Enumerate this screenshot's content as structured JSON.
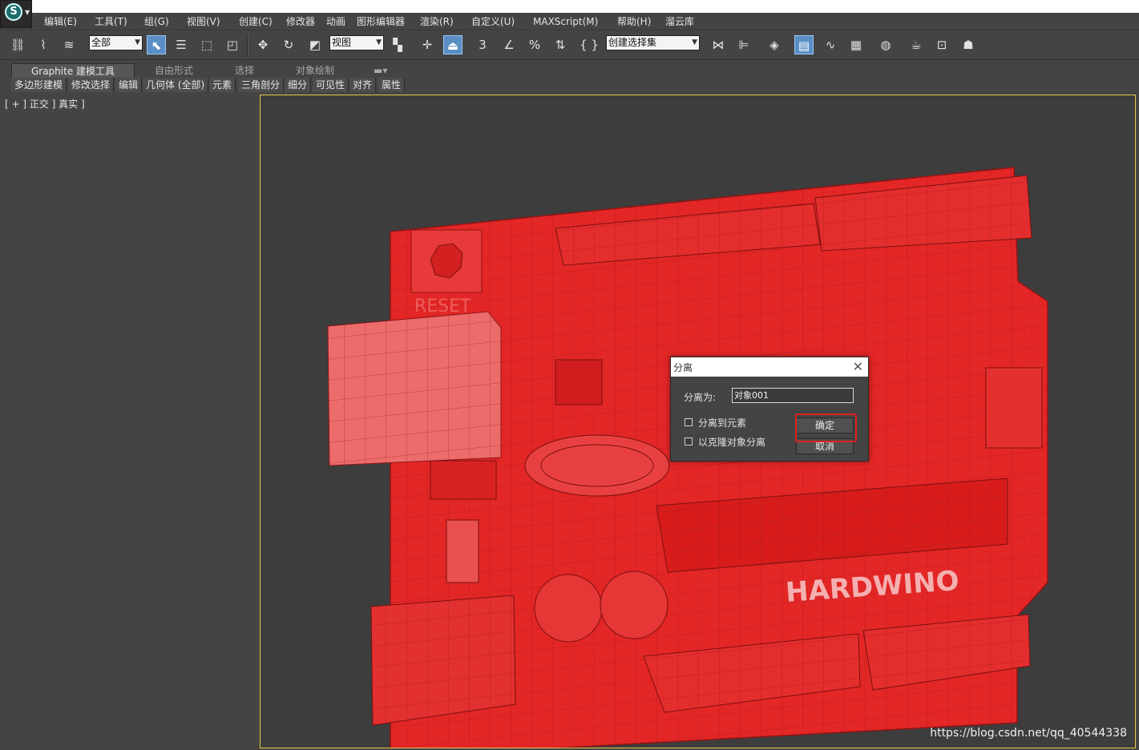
{
  "app": {
    "logo": "3ds-max-logo"
  },
  "menu": [
    "编辑(E)",
    "工具(T)",
    "组(G)",
    "视图(V)",
    "创建(C)",
    "修改器",
    "动画",
    "图形编辑器",
    "渲染(R)",
    "自定义(U)",
    "MAXScript(M)",
    "帮助(H)",
    "溜云库"
  ],
  "toolbar": {
    "selection_filter": "全部",
    "reference_coord": "视图",
    "named_selection_placeholder": "创建选择集",
    "snap_3": "3",
    "percent_snap": "%"
  },
  "ribbon": {
    "tabs": [
      "Graphite 建模工具",
      "自由形式",
      "选择",
      "对象绘制"
    ],
    "panels": [
      "多边形建模",
      "修改选择",
      "编辑",
      "几何体 (全部)",
      "元素",
      "三角剖分",
      "细分",
      "可见性",
      "对齐",
      "属性"
    ]
  },
  "viewport": {
    "label": "[ + ] 正交 ] 真实 ]",
    "model_text": "HARDWINO",
    "silk_text": "RESET"
  },
  "watermark": "https://blog.csdn.net/qq_40544338",
  "dialog": {
    "title": "分离",
    "detach_as_label": "分离为:",
    "detach_name": "对象001",
    "detach_to_element": "分离到元素",
    "detach_as_clone": "以克隆对象分离",
    "ok": "确定",
    "cancel": "取消"
  },
  "colors": {
    "model": "#e32626",
    "viewport_border": "#e6c84a",
    "highlight": "#e0201c"
  }
}
